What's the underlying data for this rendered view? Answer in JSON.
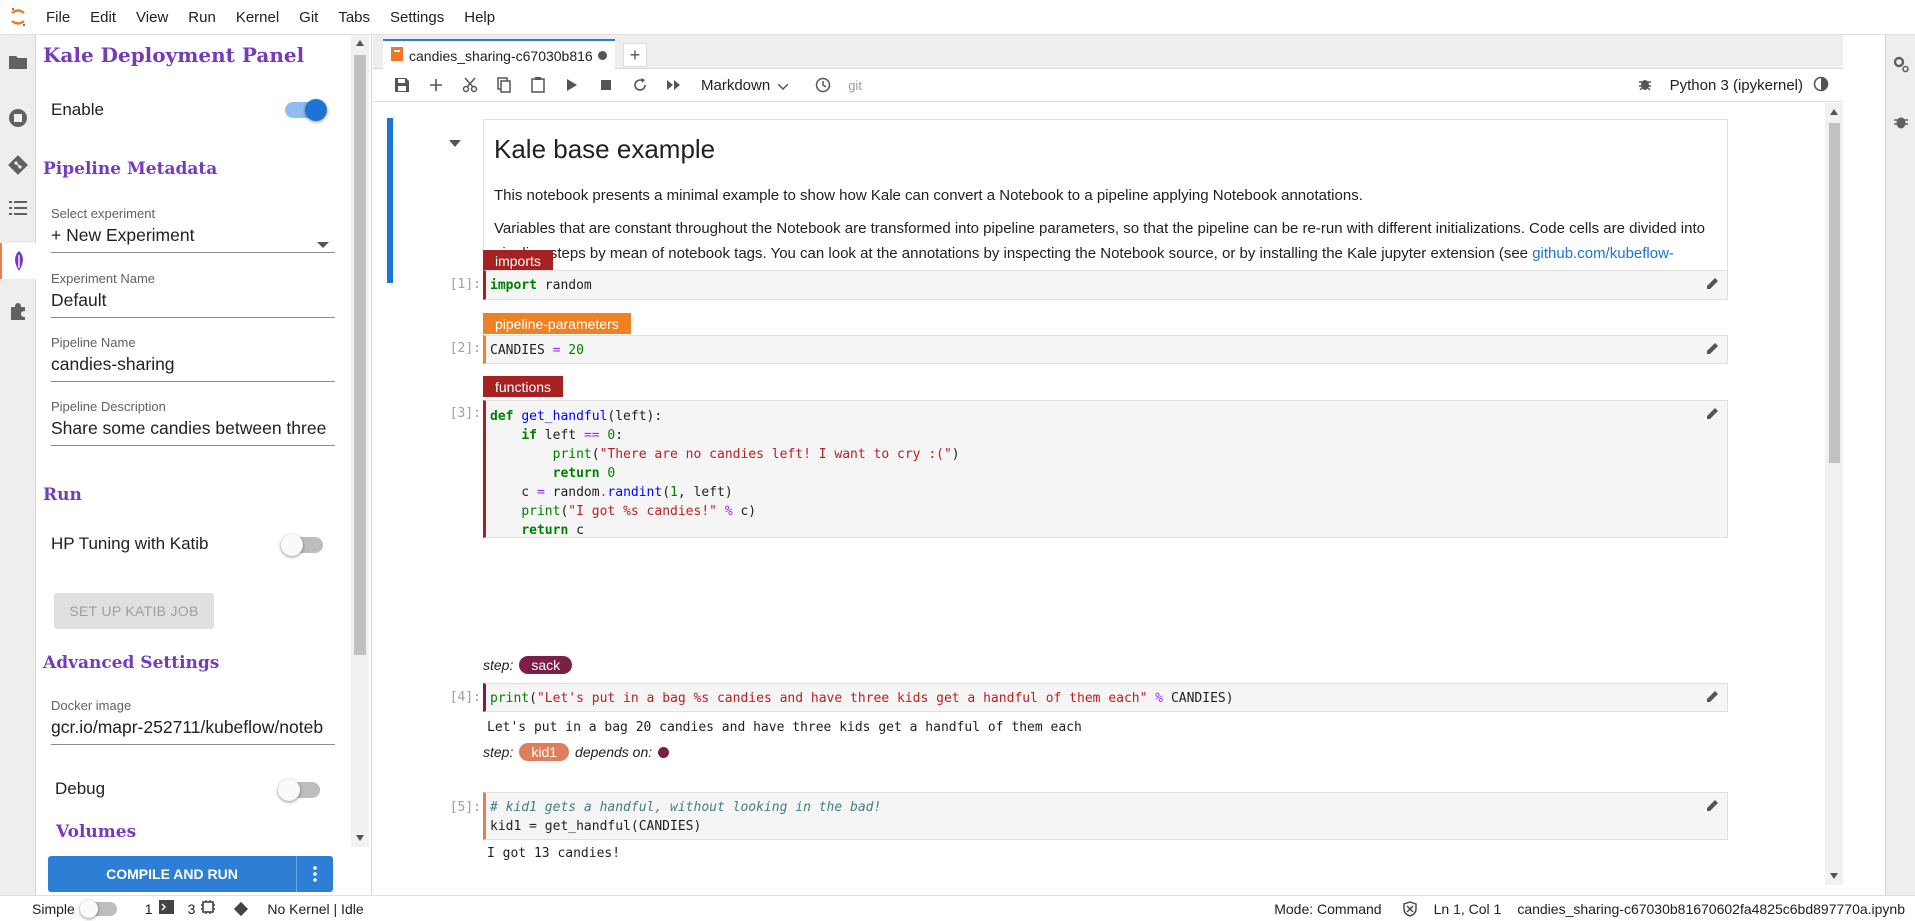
{
  "menubar": {
    "items": [
      "File",
      "Edit",
      "View",
      "Run",
      "Kernel",
      "Git",
      "Tabs",
      "Settings",
      "Help"
    ]
  },
  "kale_panel": {
    "title": "Kale Deployment Panel",
    "enable_label": "Enable",
    "enable_on": true,
    "section_metadata": "Pipeline Metadata",
    "experiment_label": "Select experiment",
    "experiment_value": "+ New Experiment",
    "experiment_name_label": "Experiment Name",
    "experiment_name_value": "Default",
    "pipeline_name_label": "Pipeline Name",
    "pipeline_name_value": "candies-sharing",
    "pipeline_desc_label": "Pipeline Description",
    "pipeline_desc_value": "Share some candies between three",
    "section_run": "Run",
    "katib_label": "HP Tuning with Katib",
    "katib_on": false,
    "katib_button": "SET UP KATIB JOB",
    "section_advanced": "Advanced Settings",
    "docker_label": "Docker image",
    "docker_value": "gcr.io/mapr-252711/kubeflow/noteb",
    "debug_label": "Debug",
    "debug_on": false,
    "section_volumes": "Volumes",
    "compile_button": "COMPILE AND RUN"
  },
  "tab": {
    "title": "candies_sharing-c67030b816",
    "add": "+"
  },
  "toolbar": {
    "cell_type": "Markdown",
    "git_label": "git",
    "kernel_name": "Python 3 (ipykernel)"
  },
  "notebook": {
    "heading": "Kale base example",
    "para1": "This notebook presents a minimal example to show how Kale can convert a Notebook to a pipeline applying Notebook annotations.",
    "para2": "Variables that are constant throughout the Notebook are transformed into pipeline parameters, so that the pipeline can be re-run with different initializations. Code cells are divided into pipeline steps by mean of notebook tags. You can look at the annotations by inspecting the Notebook source, or by installing the Kale jupyter extension (see",
    "para2_link": "github.com/kubeflow-kale/kale",
    "para2_end": ")",
    "cells": [
      {
        "prompt": "[1]:",
        "tag": "imports",
        "tag_color": "#a62121"
      },
      {
        "prompt": "[2]:",
        "tag": "pipeline-parameters",
        "tag_color": "#ee8123"
      },
      {
        "prompt": "[3]:",
        "tag": "functions",
        "tag_color": "#a62121"
      },
      {
        "prompt": "[4]:",
        "step_label": "step:",
        "step": "sack",
        "step_color": "#7b1f47",
        "output": "Let's put in a bag 20 candies and have three kids get a handful of them each"
      },
      {
        "prompt": "[5]:",
        "step_label": "step:",
        "step": "kid1",
        "step_color": "#e07d5b",
        "depends_label": "depends on:",
        "depends_color": "#7b1f47",
        "output": "I got 13 candies!"
      }
    ],
    "code": {
      "c1": {
        "kw": "import",
        "rest": " random"
      },
      "c2": {
        "name": "CANDIES",
        "eq": " = ",
        "num": "20"
      },
      "c3": [
        "def get_handful(left):",
        "    if left == 0:",
        "        print(\"There are no candies left! I want to cry :(\")",
        "        return 0",
        "    c = random.randint(1, left)",
        "    print(\"I got %s candies!\" % c)",
        "    return c"
      ],
      "c4": {
        "fn": "print",
        "open": "(",
        "str": "\"Let's put in a bag %s candies and have three kids get a handful of them each\"",
        "op": " % ",
        "rest": "CANDIES)"
      },
      "c5": {
        "comment": "# kid1 gets a handful, without looking in the bad!",
        "line2": "kid1 = get_handful(CANDIES)"
      }
    }
  },
  "statusbar": {
    "simple_label": "Simple",
    "terminals": "1",
    "kernels": "3",
    "kernel_status": "No Kernel | Idle",
    "mode": "Mode: Command",
    "position": "Ln 1, Col 1",
    "filename": "candies_sharing-c67030b81670602fa4825c6bd897770a.ipynb"
  }
}
